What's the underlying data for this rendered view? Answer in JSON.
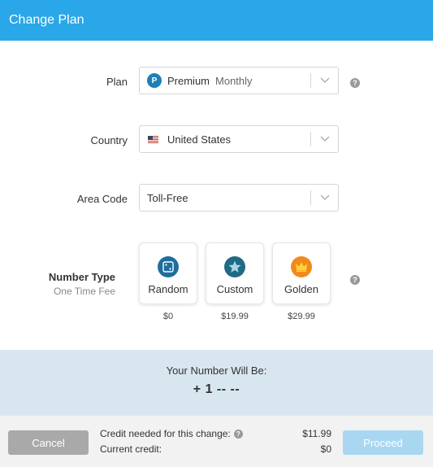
{
  "header": {
    "title": "Change Plan"
  },
  "plan": {
    "label": "Plan",
    "badge": "P",
    "value_name": "Premium",
    "value_period": "Monthly"
  },
  "country": {
    "label": "Country",
    "value": "United States",
    "flag": "us-flag-icon"
  },
  "area_code": {
    "label": "Area Code",
    "value": "Toll-Free"
  },
  "number_type": {
    "title": "Number Type",
    "subtitle": "One Time Fee",
    "options": [
      {
        "label": "Random",
        "price": "$0",
        "icon": "dice-icon",
        "color": "#1e6e9e"
      },
      {
        "label": "Custom",
        "price": "$19.99",
        "icon": "star-icon",
        "color": "#1f6a85"
      },
      {
        "label": "Golden",
        "price": "$29.99",
        "icon": "crown-icon",
        "color": "#f08a1c"
      }
    ]
  },
  "number_preview": {
    "title": "Your Number Will Be:",
    "number": "+ 1 -- --"
  },
  "footer": {
    "cancel": "Cancel",
    "proceed": "Proceed",
    "credit_needed_label": "Credit needed for this change:",
    "credit_needed_value": "$11.99",
    "current_credit_label": "Current credit:",
    "current_credit_value": "$0"
  },
  "colors": {
    "accent": "#2aa7e8",
    "preview_bg": "#d8e6ef",
    "proceed_disabled": "#a9d7f2",
    "cancel": "#a9a9a9"
  }
}
